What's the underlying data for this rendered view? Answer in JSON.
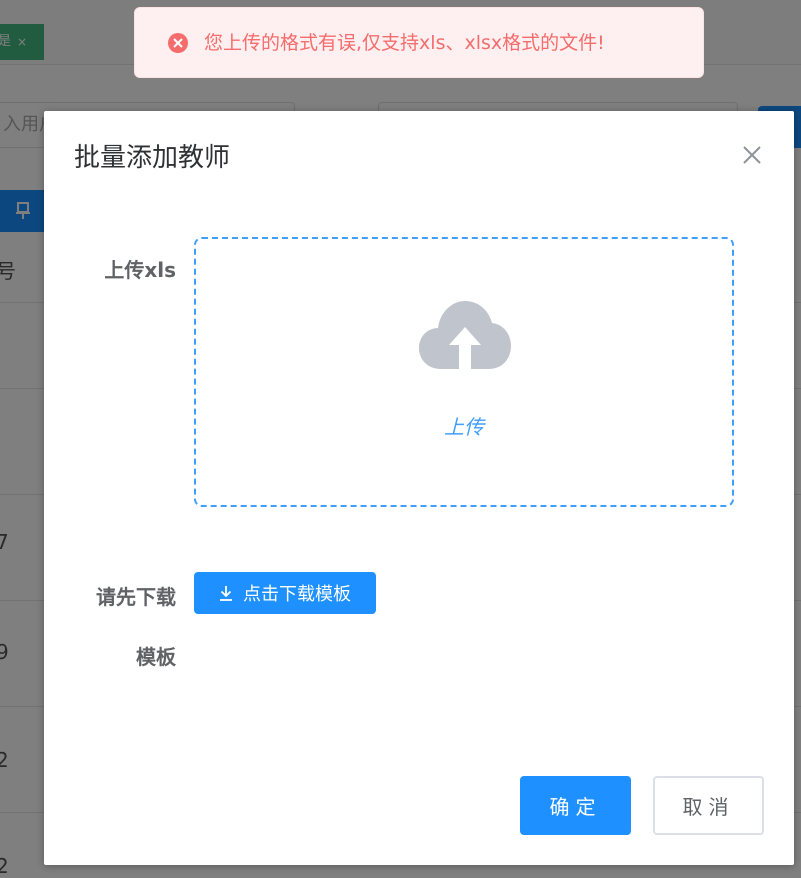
{
  "background": {
    "tab_label": "是",
    "tab_close": "×",
    "search_placeholder": "入用户",
    "table_header": "号",
    "row_values": [
      "",
      "",
      "7",
      "9",
      "2",
      "2"
    ]
  },
  "dialog": {
    "title": "批量添加教师",
    "close_icon": "close-icon",
    "upload_label": "上传xls",
    "upload_text": "上传",
    "upload_icon": "cloud-upload-icon",
    "download_label_line1": "请先下载",
    "download_label_line2": "模板",
    "download_button": "点击下载模板",
    "download_icon": "download-icon",
    "confirm_button": "确定",
    "cancel_button": "取消"
  },
  "message": {
    "type": "error",
    "icon": "error-circle-icon",
    "text": "您上传的格式有误,仅支持xls、xlsx格式的文件!"
  },
  "colors": {
    "primary": "#1e90ff",
    "error": "#f56c6c",
    "upload_border": "#409eff",
    "cloud_icon": "#c0c4cc"
  }
}
